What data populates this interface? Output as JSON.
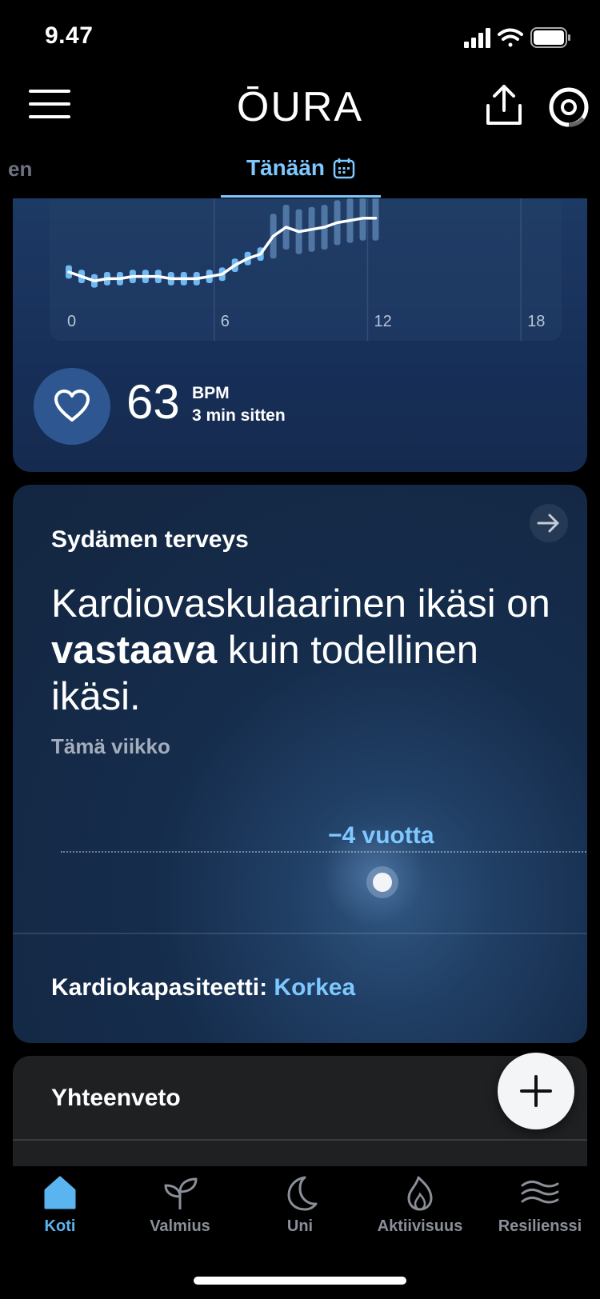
{
  "status_bar": {
    "time": "9.47"
  },
  "header": {
    "logo": "ŌURA"
  },
  "tabs": {
    "previous_partial": "en",
    "today": "Tänään"
  },
  "heart_rate": {
    "value": "63",
    "unit": "BPM",
    "time_ago": "3 min sitten"
  },
  "chart_data": {
    "type": "line",
    "x_ticks": [
      "0",
      "6",
      "12",
      "18"
    ],
    "xlim": [
      0,
      24
    ],
    "x": [
      0,
      0.5,
      1,
      1.5,
      2,
      2.5,
      3,
      3.5,
      4,
      4.5,
      5,
      5.5,
      6,
      6.5,
      7,
      7.5,
      8,
      8.5,
      9,
      9.5,
      10,
      10.5,
      11,
      11.5,
      12
    ],
    "values": [
      60,
      58,
      56,
      57,
      57,
      58,
      58,
      58,
      57,
      57,
      57,
      58,
      59,
      63,
      66,
      68,
      76,
      80,
      78,
      79,
      80,
      82,
      83,
      84,
      84
    ],
    "ylim": [
      50,
      95
    ],
    "grid": true
  },
  "heart_health": {
    "title": "Sydämen terveys",
    "headline_pre": "Kardiovaskulaarinen ikäsi on ",
    "headline_bold": "vastaava",
    "headline_post": " kuin todellinen ikäsi.",
    "period": "Tämä viikko",
    "difference": "−4 vuotta",
    "capacity_label": "Kardiokapasiteetti:",
    "capacity_value": "Korkea"
  },
  "summary": {
    "title": "Yhteenveto"
  },
  "nav": {
    "items": [
      {
        "label": "Koti",
        "icon": "home-icon",
        "active": true
      },
      {
        "label": "Valmius",
        "icon": "sprout-icon",
        "active": false
      },
      {
        "label": "Uni",
        "icon": "moon-icon",
        "active": false
      },
      {
        "label": "Aktiivisuus",
        "icon": "flame-icon",
        "active": false
      },
      {
        "label": "Resilienssi",
        "icon": "waves-icon",
        "active": false
      }
    ]
  },
  "colors": {
    "accent": "#7ec8ff",
    "nav_active": "#5ab4f0",
    "card_bg": "#152c4b"
  }
}
